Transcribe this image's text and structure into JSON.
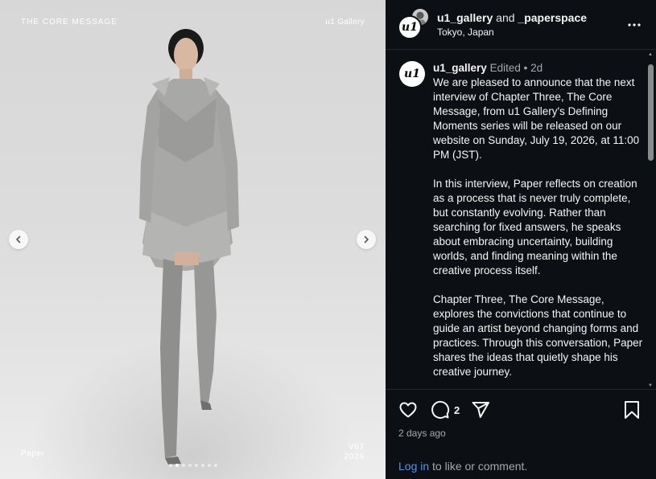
{
  "media": {
    "overlay_title": "THE CORE MESSAGE",
    "overlay_brand": "u1 Gallery",
    "overlay_name": "Paper",
    "overlay_version": "V67",
    "overlay_year": "2026",
    "carousel_dots": 8,
    "active_dot": 1,
    "prev_icon": "chevron-left-icon",
    "next_icon": "chevron-right-icon"
  },
  "header": {
    "username": "u1_gallery",
    "conjunction": "and",
    "collaborator": "_paperspace",
    "location": "Tokyo, Japan",
    "avatar_text": "u1"
  },
  "post": {
    "username": "u1_gallery",
    "edited": "Edited",
    "bullet": "•",
    "age": "2d",
    "avatar_text": "u1",
    "paragraphs": [
      "We are pleased to announce that the next interview of Chapter Three, The Core Message, from u1 Gallery's Defining Moments series will be released on our website on Sunday, July 19, 2026, at 11:00 PM (JST).",
      "In this interview, Paper reflects on creation as a process that is never truly complete, but constantly evolving. Rather than searching for fixed answers, he speaks about embracing uncertainty, building worlds, and finding meaning within the creative process itself.",
      "Chapter Three, The Core Message, explores the convictions that continue to guide an artist beyond changing forms and practices. Through this conversation, Paper shares the ideas that quietly shape his creative journey."
    ]
  },
  "actions": {
    "comment_count": "2",
    "timestamp": "2 days ago",
    "login_link": "Log in",
    "login_suffix": " to like or comment."
  },
  "colors": {
    "panel_bg": "#0c1014",
    "text": "#f5f5f5",
    "muted": "#a8a8a8",
    "link": "#4a95f5"
  }
}
